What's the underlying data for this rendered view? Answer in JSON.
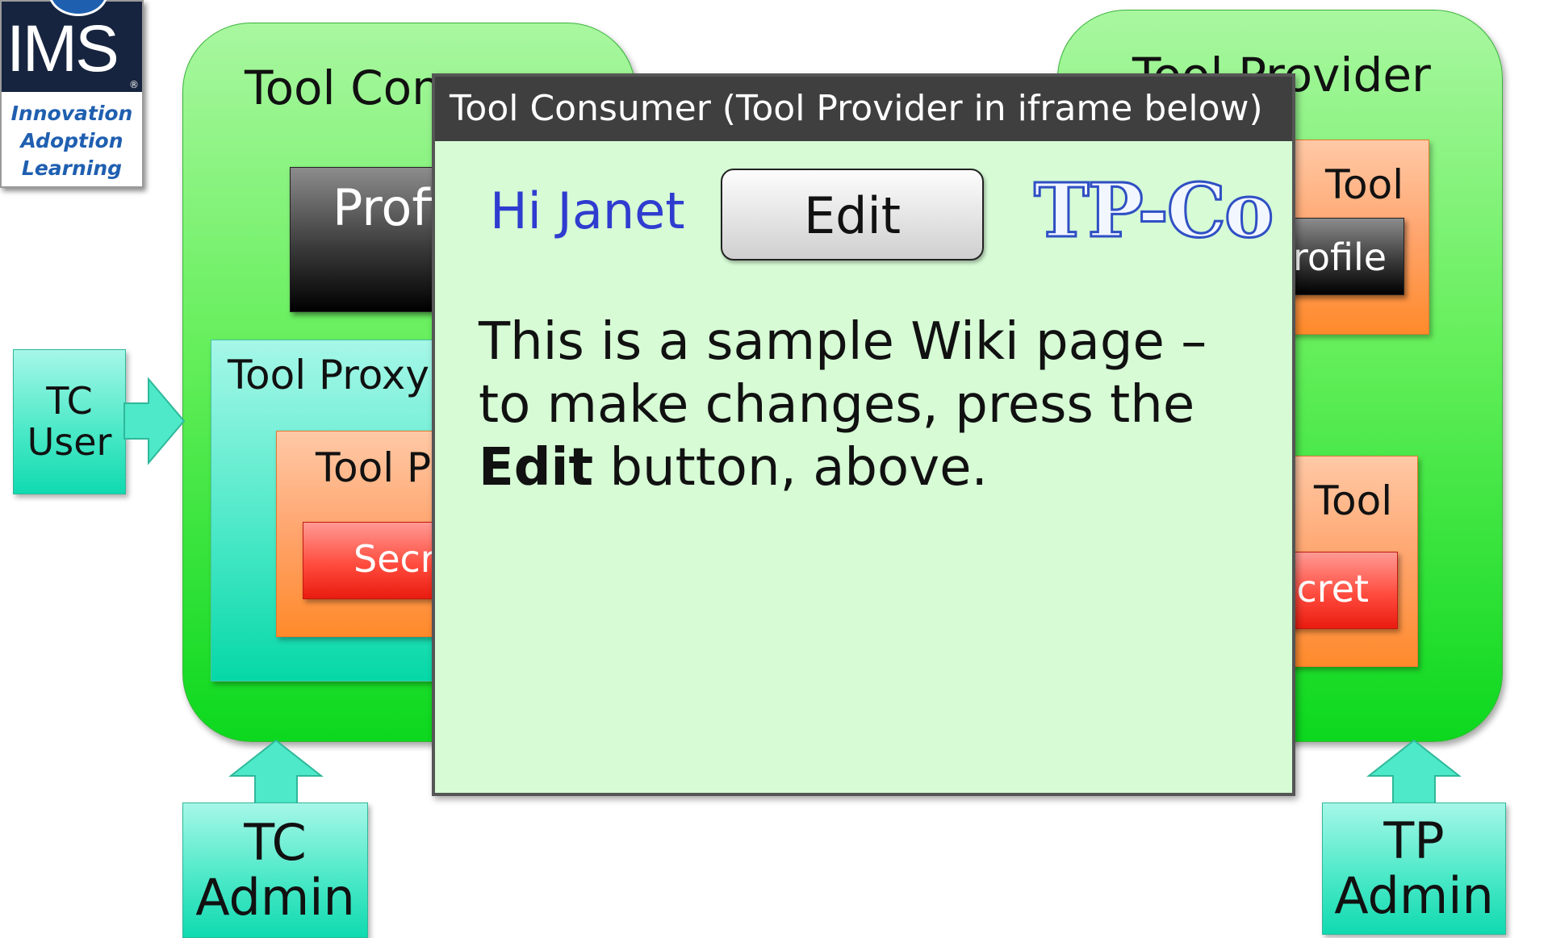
{
  "logo": {
    "name": "IMS",
    "registered": "®",
    "tagline": [
      "Innovation",
      "Adoption",
      "Learning"
    ]
  },
  "tool_consumer": {
    "title": "Tool Consumer",
    "profile_button": "Profile",
    "tool_proxy": {
      "label": "Tool Proxy",
      "tool_provider_label": "Tool Provider",
      "secret_button": "Secret"
    }
  },
  "tool_provider": {
    "title": "Tool Provider",
    "panel_top": {
      "label": "Tool",
      "profile_button": "Profile"
    },
    "panel_bottom": {
      "label": "Tool",
      "secret_button": "Secret"
    }
  },
  "callouts": {
    "tc_user": "TC User",
    "tc_admin": "TC Admin",
    "tp_admin": "TP Admin"
  },
  "iframe": {
    "title": "Tool Consumer (Tool Provider in iframe below)",
    "greeting": "Hi Janet",
    "edit_button": "Edit",
    "brand": "TP-Co",
    "body_before": "This is a sample Wiki page – to make changes, press the ",
    "body_bold": "Edit",
    "body_after": " button, above."
  },
  "colors": {
    "container_green": "#66ef5c",
    "proxy_cyan": "#4de9c8",
    "tool_orange": "#ffa46c",
    "secret_red": "#ff4c3e",
    "greeting_blue": "#2f3ccf",
    "iframe_background": "#d6fbd5"
  }
}
